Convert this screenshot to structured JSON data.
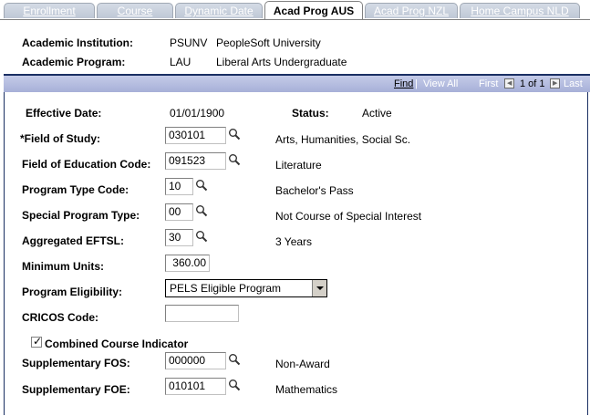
{
  "tabs": [
    "Enrollment",
    "Course",
    "Dynamic Date",
    "Acad Prog AUS",
    "Acad Prog NZL",
    "Home Campus NLD"
  ],
  "header": {
    "institution_label": "Academic Institution:",
    "institution_code": "PSUNV",
    "institution_name": "PeopleSoft University",
    "program_label": "Academic Program:",
    "program_code": "LAU",
    "program_name": "Liberal Arts Undergraduate"
  },
  "nav": {
    "find": "Find",
    "separator": " | ",
    "view_all": "View All",
    "first": "First",
    "page_of": "1 of 1",
    "last": "Last"
  },
  "form": {
    "effective_date_label": "Effective Date:",
    "effective_date": "01/01/1900",
    "status_label": "Status:",
    "status": "Active",
    "field_of_study_label": "*Field of Study:",
    "field_of_study": "030101",
    "field_of_study_desc": "Arts, Humanities, Social Sc.",
    "field_of_education_label": "Field of Education Code:",
    "field_of_education": "091523",
    "field_of_education_desc": "Literature",
    "program_type_label": "Program Type Code:",
    "program_type": "10",
    "program_type_desc": "Bachelor's Pass",
    "special_program_label": "Special Program Type:",
    "special_program": "00",
    "special_program_desc": "Not Course of Special Interest",
    "eftsl_label": "Aggregated EFTSL:",
    "eftsl": "30",
    "eftsl_desc": "3 Years",
    "min_units_label": "Minimum Units:",
    "min_units": "360.00",
    "eligibility_label": "Program Eligibility:",
    "eligibility": "PELS Eligible Program",
    "cricos_label": "CRICOS Code:",
    "cricos": "",
    "combined_label": "Combined Course Indicator",
    "combined_checked": true,
    "supp_fos_label": "Supplementary FOS:",
    "supp_fos": "000000",
    "supp_fos_desc": "Non-Award",
    "supp_foe_label": "Supplementary FOE:",
    "supp_foe": "010101",
    "supp_foe_desc": "Mathematics"
  },
  "icons": {
    "lookup": "magnifier-icon",
    "first": "left-arrow-icon",
    "last": "right-arrow-icon",
    "dropdown": "chevron-down-icon",
    "check": "checkmark-icon"
  }
}
